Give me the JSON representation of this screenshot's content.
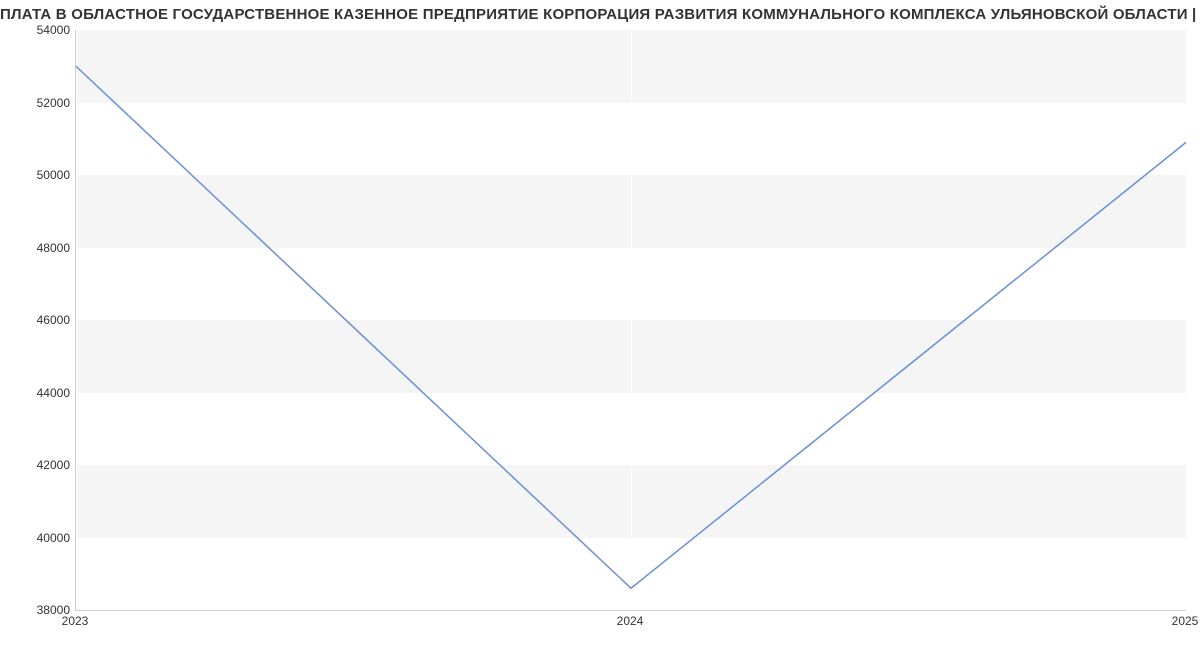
{
  "title": "ПЛАТА В ОБЛАСТНОЕ ГОСУДАРСТВЕННОЕ КАЗЕННОЕ ПРЕДПРИЯТИЕ КОРПОРАЦИЯ РАЗВИТИЯ КОММУНАЛЬНОГО КОМПЛЕКСА УЛЬЯНОВСКОЙ ОБЛАСТИ | Данные mnogo.w",
  "chart_data": {
    "type": "line",
    "x": [
      2023,
      2024,
      2025
    ],
    "values": [
      53000,
      38600,
      50900
    ],
    "xlabel": "",
    "ylabel": "",
    "xticks": [
      "2023",
      "2024",
      "2025"
    ],
    "yticks": [
      38000,
      40000,
      42000,
      44000,
      46000,
      48000,
      50000,
      52000,
      54000
    ],
    "ylim": [
      38000,
      54000
    ],
    "xlim": [
      2023,
      2025
    ],
    "grid": true
  }
}
